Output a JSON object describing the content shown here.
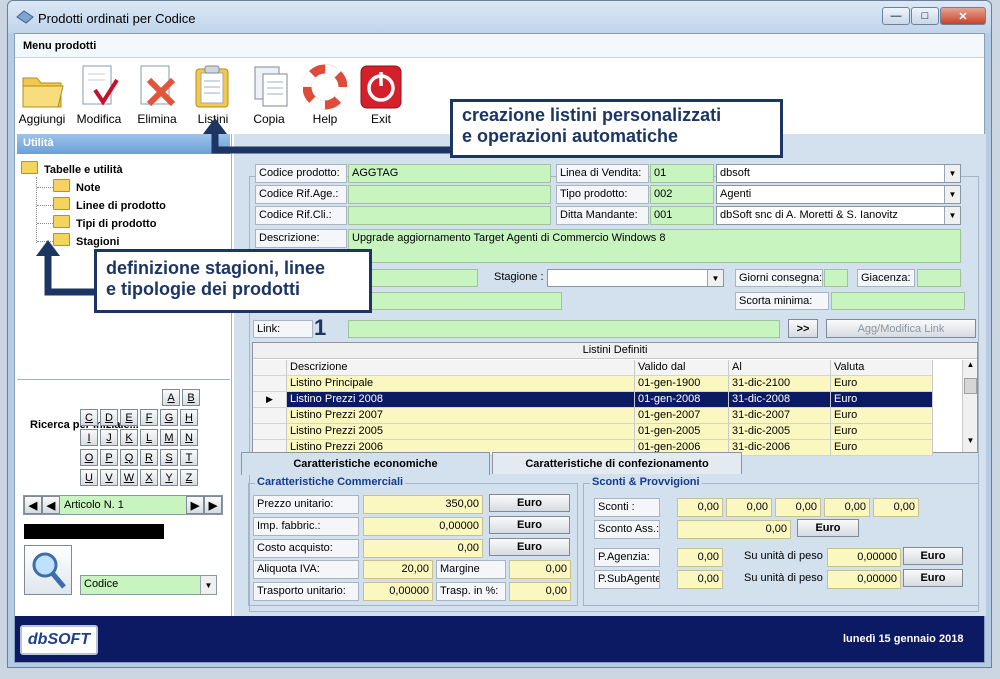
{
  "window": {
    "title": "Prodotti ordinati per Codice"
  },
  "menu": {
    "label": "Menu prodotti"
  },
  "toolbar": [
    {
      "label": "Aggiungi",
      "icon": "folder-icon"
    },
    {
      "label": "Modifica",
      "icon": "edit-icon"
    },
    {
      "label": "Elimina",
      "icon": "delete-icon"
    },
    {
      "label": "Listini",
      "icon": "clipboard-icon"
    },
    {
      "label": "Copia",
      "icon": "copy-icon"
    },
    {
      "label": "Help",
      "icon": "lifebuoy-icon"
    },
    {
      "label": "Exit",
      "icon": "exit-icon"
    }
  ],
  "utility": {
    "header": "Utilità",
    "root": "Tabelle e utilità",
    "items": [
      "Note",
      "Linee di prodotto",
      "Tipi di prodotto",
      "Stagioni"
    ]
  },
  "search": {
    "label": "Ricerca per iniziale...",
    "letters": [
      "A",
      "B",
      "C",
      "D",
      "E",
      "F",
      "G",
      "H",
      "I",
      "J",
      "K",
      "L",
      "M",
      "N",
      "O",
      "P",
      "Q",
      "R",
      "S",
      "T",
      "U",
      "V",
      "W",
      "X",
      "Y",
      "Z"
    ],
    "record": "Articolo N. 1",
    "order_by": "Codice"
  },
  "form": {
    "codice_label": "Codice prodotto:",
    "codice": "AGGTAG",
    "rif_age_label": "Codice Rif.Age.:",
    "rif_age": "",
    "rif_cli_label": "Codice Rif.Cli.:",
    "rif_cli": "",
    "linea_label": "Linea di Vendita:",
    "linea_code": "01",
    "linea": "dbsoft",
    "tipo_label": "Tipo prodotto:",
    "tipo_code": "002",
    "tipo": "Agenti",
    "ditta_label": "Ditta Mandante:",
    "ditta_code": "001",
    "ditta": "dbSoft snc di A. Moretti & S. Ianovitz",
    "descrizione_label": "Descrizione:",
    "descrizione": "Upgrade aggiornamento Target Agenti di Commercio Windows 8",
    "stagione_label": "Stagione :",
    "stagione": "",
    "giorni_label": "Giorni consegna:",
    "giorni": "",
    "giacenza_label": "Giacenza:",
    "giacenza": "",
    "scorta_label": "Scorta minima:",
    "scorta": "",
    "link_label": "Link:",
    "link": "",
    "link_go": ">>",
    "link_edit": "Agg/Modifica Link",
    "note_marker": "1"
  },
  "listini": {
    "title": "Listini Definiti",
    "columns": [
      "Descrizione",
      "Valido dal",
      "Al",
      "Valuta"
    ],
    "rows": [
      [
        "Listino Principale",
        "01-gen-1900",
        "31-dic-2100",
        "Euro"
      ],
      [
        "Listino Prezzi 2008",
        "01-gen-2008",
        "31-dic-2008",
        "Euro"
      ],
      [
        "Listino Prezzi 2007",
        "01-gen-2007",
        "31-dic-2007",
        "Euro"
      ],
      [
        "Listino Prezzi 2005",
        "01-gen-2005",
        "31-dic-2005",
        "Euro"
      ],
      [
        "Listino Prezzi 2006",
        "01-gen-2006",
        "31-dic-2006",
        "Euro"
      ]
    ],
    "selected_index": 1
  },
  "tabs": [
    "Caratteristiche economiche",
    "Caratteristiche di confezionamento"
  ],
  "commerciali": {
    "title": "Caratteristiche Commerciali",
    "prezzo_label": "Prezzo unitario:",
    "prezzo": "350,00",
    "imp_label": "Imp. fabbric.:",
    "imp": "0,00000",
    "costo_label": "Costo acquisto:",
    "costo": "0,00",
    "iva_label": "Aliquota IVA:",
    "iva": "20,00",
    "margine_label": "Margine",
    "margine": "0,00",
    "trasporto_label": "Trasporto unitario:",
    "trasporto": "0,00000",
    "trasp_pct_label": "Trasp. in %:",
    "trasp_pct": "0,00",
    "currency": "Euro"
  },
  "sconti": {
    "title": "Sconti & Provvigioni",
    "sconti_label": "Sconti :",
    "sconti": [
      "0,00",
      "0,00",
      "0,00",
      "0,00",
      "0,00"
    ],
    "sconto_ass_label": "Sconto Ass.:",
    "sconto_ass": "0,00",
    "agenzia_label": "P.Agenzia:",
    "agenzia": "0,00",
    "subagente_label": "P.SubAgente:",
    "subagente": "0,00",
    "peso_label": "Su unità di peso",
    "peso1": "0,00000",
    "peso2": "0,00000",
    "currency": "Euro"
  },
  "footer": {
    "logo": "dbSOFT",
    "date": "lunedì 15 gennaio 2018"
  },
  "callouts": {
    "listini_line1": "creazione listini personalizzati",
    "listini_line2": "e operazioni automatiche",
    "stagioni_line1": "definizione stagioni, linee",
    "stagioni_line2": "e tipologie dei prodotti"
  },
  "colors": {
    "field_green": "#c8f4c0",
    "field_yellow": "#fbf7c0",
    "selection": "#0c1a63",
    "footer": "#0c1a63",
    "callout": "#1c3563"
  }
}
